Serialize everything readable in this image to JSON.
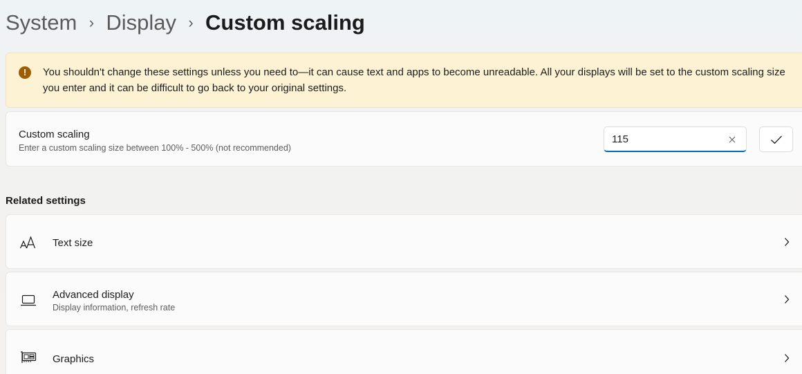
{
  "breadcrumb": {
    "items": [
      "System",
      "Display"
    ],
    "current": "Custom scaling"
  },
  "warning": {
    "icon": "warning-icon",
    "text": "You shouldn't change these settings unless you need to—it can cause text and apps to become unreadable. All your displays will be set to the custom scaling size you enter and it can be difficult to go back to your original settings."
  },
  "custom_scaling": {
    "title": "Custom scaling",
    "description": "Enter a custom scaling size between 100% - 500% (not recommended)",
    "value": "115"
  },
  "related": {
    "heading": "Related settings",
    "items": [
      {
        "title": "Text size",
        "subtitle": "",
        "icon": "text-size-icon"
      },
      {
        "title": "Advanced display",
        "subtitle": "Display information, refresh rate",
        "icon": "monitor-icon"
      },
      {
        "title": "Graphics",
        "subtitle": "",
        "icon": "graphics-card-icon"
      }
    ]
  },
  "colors": {
    "accent": "#0067c0",
    "warning_bg": "#fdf3d4",
    "warning_icon": "#9d5d00"
  }
}
